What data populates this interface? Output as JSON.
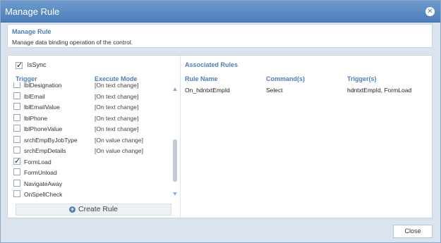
{
  "window": {
    "title": "Manage Rule"
  },
  "header": {
    "title": "Manage Rule",
    "subtitle": "Manage data binding operation of the control."
  },
  "left": {
    "issync": {
      "label": "IsSync",
      "checked": true
    },
    "col_trigger": "Trigger",
    "col_execute": "Execute Mode",
    "rows": [
      {
        "name": "lblDesignation",
        "mode": "[On text change]",
        "checked": false
      },
      {
        "name": "lblEmail",
        "mode": "[On text change]",
        "checked": false
      },
      {
        "name": "lblEmailValue",
        "mode": "[On text change]",
        "checked": false
      },
      {
        "name": "lblPhone",
        "mode": "[On text change]",
        "checked": false
      },
      {
        "name": "lblPhoneValue",
        "mode": "[On text change]",
        "checked": false
      },
      {
        "name": "srchEmpByJobType",
        "mode": "[On value change]",
        "checked": false
      },
      {
        "name": "srchEmpDetails",
        "mode": "[On value change]",
        "checked": false
      },
      {
        "name": "FormLoad",
        "mode": "",
        "checked": true
      },
      {
        "name": "FormUnload",
        "mode": "",
        "checked": false
      },
      {
        "name": "NavigateAway",
        "mode": "",
        "checked": false
      },
      {
        "name": "OnSpellCheck",
        "mode": "",
        "checked": false
      }
    ],
    "create_rule": "Create Rule"
  },
  "right": {
    "title": "Associated Rules",
    "headers": {
      "rule_name": "Rule Name",
      "commands": "Command(s)",
      "triggers": "Trigger(s)"
    },
    "rules": [
      {
        "rule_name": "On_hdntxtEmpId",
        "command": "Select",
        "triggers": "hdntxtEmpId, FormLoad"
      }
    ]
  },
  "footer": {
    "close_label": "Close"
  },
  "icons": {
    "close": "close-circle-icon",
    "add": "plus-circle-icon",
    "checkbox": "checkbox-icon"
  },
  "colors": {
    "accent": "#4d7eb9",
    "titlebar": "#5a89c2",
    "background": "#dbe4ee"
  }
}
